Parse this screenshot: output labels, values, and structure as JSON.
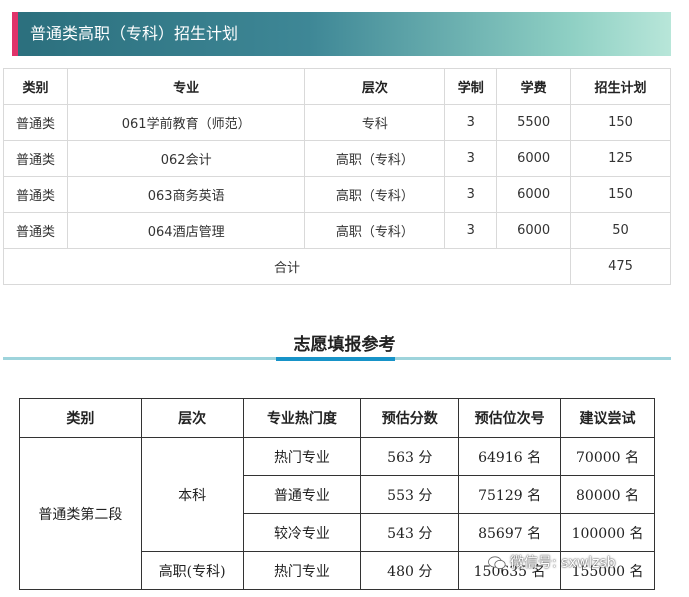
{
  "banner": {
    "title": "普通类高职（专科）招生计划"
  },
  "plan_table": {
    "headers": [
      "类别",
      "专业",
      "层次",
      "学制",
      "学费",
      "招生计划"
    ],
    "rows": [
      [
        "普通类",
        "061学前教育（师范）",
        "专科",
        "3",
        "5500",
        "150"
      ],
      [
        "普通类",
        "062会计",
        "高职（专科）",
        "3",
        "6000",
        "125"
      ],
      [
        "普通类",
        "063商务英语",
        "高职（专科）",
        "3",
        "6000",
        "150"
      ],
      [
        "普通类",
        "064酒店管理",
        "高职（专科）",
        "3",
        "6000",
        "50"
      ]
    ],
    "total_label": "合计",
    "total_value": "475"
  },
  "section": {
    "title": "志愿填报参考"
  },
  "ref_table": {
    "headers": [
      "类别",
      "层次",
      "专业热门度",
      "预估分数",
      "预估位次号",
      "建议尝试"
    ],
    "category": "普通类第二段",
    "level_undergrad": "本科",
    "level_vocational": "高职(专科)",
    "rows": [
      [
        "热门专业",
        "563 分",
        "64916 名",
        "70000 名"
      ],
      [
        "普通专业",
        "553 分",
        "75129 名",
        "80000 名"
      ],
      [
        "较冷专业",
        "543 分",
        "85697 名",
        "100000 名"
      ],
      [
        "热门专业",
        "480 分",
        "150635 名",
        "155000 名"
      ]
    ]
  },
  "watermark": {
    "text": "微信号: sxwlzsb",
    "icon": "wechat-icon"
  }
}
